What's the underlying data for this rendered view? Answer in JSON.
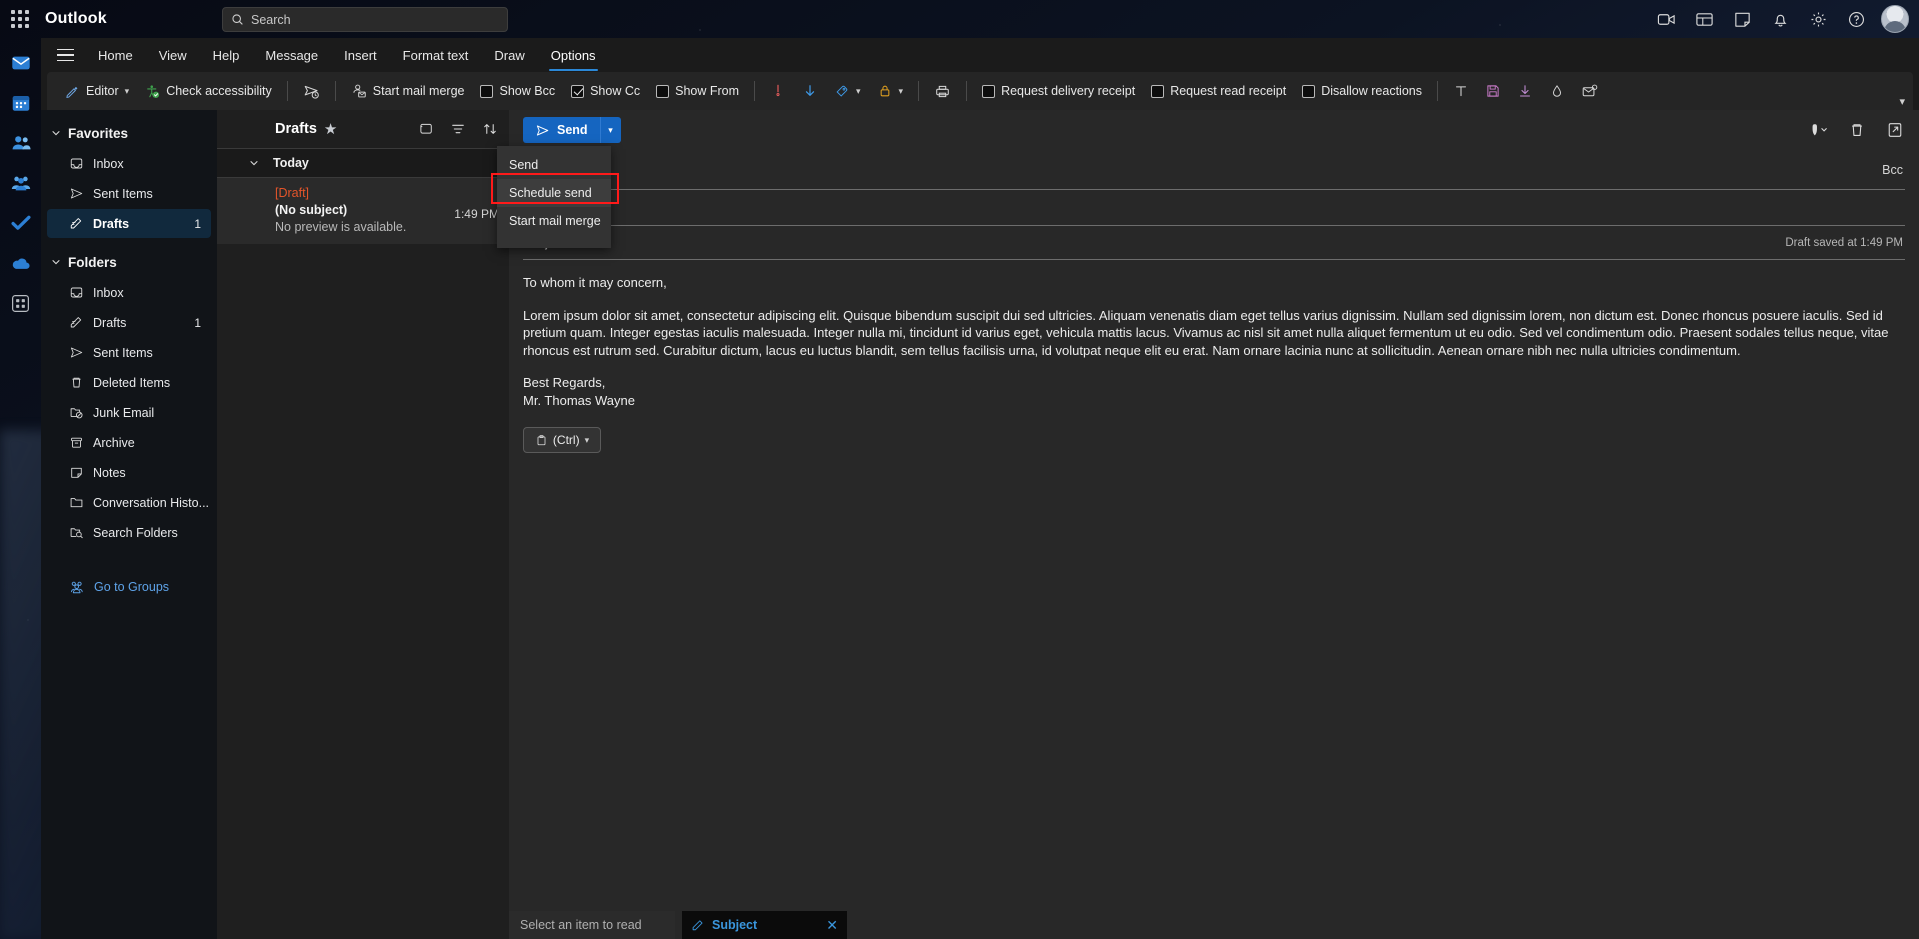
{
  "topbar": {
    "waffle_label": "app-launcher",
    "brand": "Outlook",
    "search_placeholder": "Search",
    "icons": [
      "meet-now-icon",
      "teams-icon",
      "notes-icon",
      "bell-icon",
      "gear-icon",
      "help-icon",
      "avatar"
    ]
  },
  "rail": {
    "items": [
      {
        "name": "mail",
        "label": "Mail"
      },
      {
        "name": "calendar",
        "label": "Calendar"
      },
      {
        "name": "people",
        "label": "People"
      },
      {
        "name": "groups",
        "label": "Groups"
      },
      {
        "name": "to-do",
        "label": "To Do"
      },
      {
        "name": "onedrive",
        "label": "OneDrive"
      },
      {
        "name": "apps",
        "label": "More apps"
      }
    ]
  },
  "ribbon": {
    "tabs": [
      {
        "label": "Home",
        "active": false
      },
      {
        "label": "View",
        "active": false
      },
      {
        "label": "Help",
        "active": false
      },
      {
        "label": "Message",
        "active": false
      },
      {
        "label": "Insert",
        "active": false
      },
      {
        "label": "Format text",
        "active": false
      },
      {
        "label": "Draw",
        "active": false
      },
      {
        "label": "Options",
        "active": true
      }
    ],
    "items": {
      "editor": "Editor",
      "check_accessibility": "Check accessibility",
      "start_mail_merge": "Start mail merge",
      "show_bcc": "Show Bcc",
      "show_cc": "Show Cc",
      "show_from": "Show From",
      "request_delivery_receipt": "Request delivery receipt",
      "request_read_receipt": "Request read receipt",
      "disallow_reactions": "Disallow reactions"
    },
    "checkbox_states": {
      "show_bcc": "off",
      "show_cc": "on",
      "show_from": "off",
      "request_delivery_receipt": "off",
      "request_read_receipt": "off",
      "disallow_reactions": "off"
    }
  },
  "folder_pane": {
    "favorites": {
      "title": "Favorites",
      "items": [
        {
          "label": "Inbox",
          "icon": "inbox-icon",
          "count": "",
          "selected": false
        },
        {
          "label": "Sent Items",
          "icon": "send-icon",
          "count": "",
          "selected": false
        },
        {
          "label": "Drafts",
          "icon": "draft-icon",
          "count": "1",
          "selected": true
        }
      ]
    },
    "folders": {
      "title": "Folders",
      "items": [
        {
          "label": "Inbox",
          "icon": "inbox-icon",
          "count": "",
          "selected": false
        },
        {
          "label": "Drafts",
          "icon": "draft-icon",
          "count": "1",
          "selected": false
        },
        {
          "label": "Sent Items",
          "icon": "send-icon",
          "count": "",
          "selected": false
        },
        {
          "label": "Deleted Items",
          "icon": "trash-icon",
          "count": "",
          "selected": false
        },
        {
          "label": "Junk Email",
          "icon": "junk-folder-icon",
          "count": "",
          "selected": false
        },
        {
          "label": "Archive",
          "icon": "archive-icon",
          "count": "",
          "selected": false
        },
        {
          "label": "Notes",
          "icon": "note-icon",
          "count": "",
          "selected": false
        },
        {
          "label": "Conversation Histo...",
          "icon": "folder-icon",
          "count": "",
          "selected": false
        },
        {
          "label": "Search Folders",
          "icon": "search-folder-icon",
          "count": "",
          "selected": false
        }
      ]
    },
    "go_to_groups": "Go to Groups"
  },
  "message_list": {
    "title": "Drafts",
    "star_icon": "star-filled-icon",
    "header_icons": [
      "copilot-icon",
      "filter-icon",
      "sort-icon"
    ],
    "group_label": "Today",
    "messages": [
      {
        "badge": "[Draft]",
        "subject": "(No subject)",
        "preview": "No preview is available.",
        "time": "1:49 PM"
      }
    ]
  },
  "compose": {
    "send_label": "Send",
    "send_icon": "send-plane-icon",
    "toolbar_icons": [
      "shield-chevron-icon",
      "trash-icon",
      "popout-icon"
    ],
    "to_placeholder": "",
    "bcc_label": "Bcc",
    "subject_placeholder": "Subject",
    "draft_saved": "Draft saved at 1:49 PM",
    "body": {
      "greeting": "To whom it may concern,",
      "paragraph": "Lorem ipsum dolor sit amet, consectetur adipiscing elit. Quisque bibendum suscipit dui sed ultricies. Aliquam venenatis diam eget tellus varius dignissim. Nullam sed dignissim lorem, non dictum est. Donec rhoncus posuere iaculis. Sed id pretium quam. Integer egestas iaculis malesuada. Integer nulla mi, tincidunt id varius eget, vehicula mattis lacus. Vivamus ac nisl sit amet nulla aliquet fermentum ut eu odio. Sed vel condimentum odio. Praesent sodales tellus neque, vitae rhoncus est rutrum sed. Curabitur dictum, lacus eu luctus blandit, sem tellus facilisis urna, id volutpat neque elit eu erat. Nam ornare lacinia nunc at sollicitudin. Aenean ornare nibh nec nulla ultricies condimentum.",
      "signoff": "Best Regards,",
      "signature": "Mr. Thomas Wayne"
    },
    "paste_button": "(Ctrl)"
  },
  "dropdown": {
    "items": [
      {
        "label": "Send",
        "highlighted": false
      },
      {
        "label": "Schedule send",
        "highlighted": true
      },
      {
        "label": "Start mail merge",
        "highlighted": false
      }
    ],
    "highlight_color": "#ff1a1a"
  },
  "bottom": {
    "select_item_text": "Select an item to read",
    "task_chip_label": "Subject",
    "task_chip_icon": "pencil-icon",
    "task_chip_close": "✕"
  },
  "colors": {
    "accent": "#2b88d8",
    "send_button": "#1565c0",
    "draft_badge": "#e4552a",
    "link": "#5ea3e8",
    "highlight_box": "#ff1a1a"
  }
}
